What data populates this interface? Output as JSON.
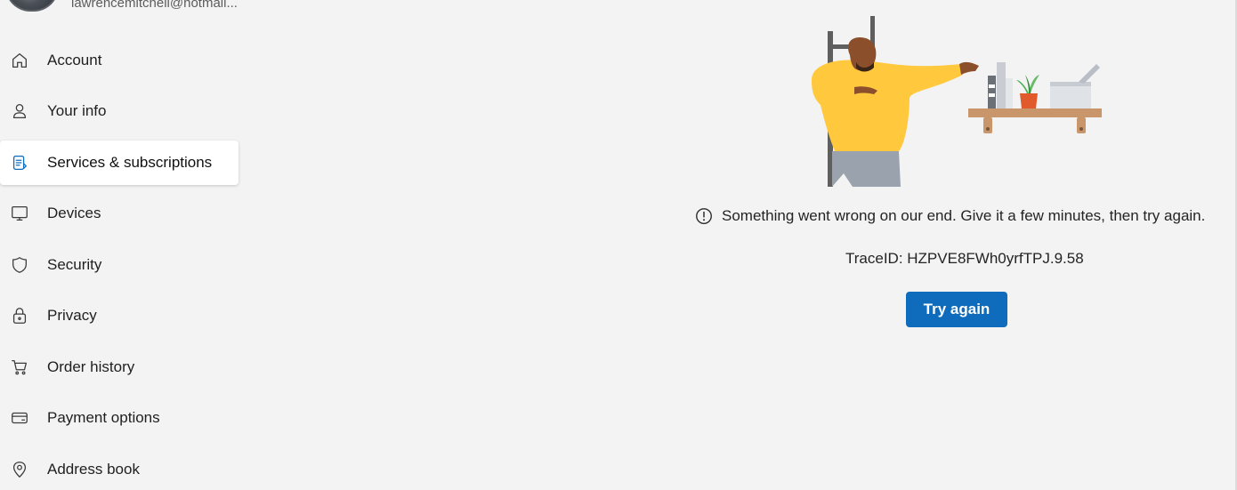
{
  "user": {
    "email": "lawrencemitchell@hotmail..."
  },
  "sidebar": {
    "items": [
      {
        "label": "Account",
        "icon": "home-icon",
        "active": false
      },
      {
        "label": "Your info",
        "icon": "person-icon",
        "active": false
      },
      {
        "label": "Services & subscriptions",
        "icon": "subscriptions-icon",
        "active": true
      },
      {
        "label": "Devices",
        "icon": "monitor-icon",
        "active": false
      },
      {
        "label": "Security",
        "icon": "shield-icon",
        "active": false
      },
      {
        "label": "Privacy",
        "icon": "lock-icon",
        "active": false
      },
      {
        "label": "Order history",
        "icon": "cart-icon",
        "active": false
      },
      {
        "label": "Payment options",
        "icon": "card-icon",
        "active": false
      },
      {
        "label": "Address book",
        "icon": "location-pin-icon",
        "active": false
      }
    ]
  },
  "main": {
    "error_message": "Something went wrong on our end. Give it a few minutes, then try again.",
    "trace_id": "TraceID: HZPVE8FWh0yrfTPJ.9.58",
    "try_again_label": "Try again"
  },
  "colors": {
    "accent": "#0f6cbd",
    "background": "#f3f3f3",
    "shirt": "#ffc83d",
    "shelf": "#c8966a"
  }
}
